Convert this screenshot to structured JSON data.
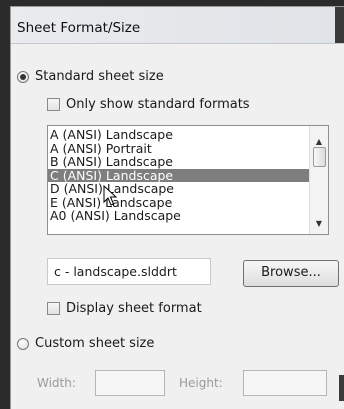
{
  "dialog": {
    "title": "Sheet Format/Size",
    "standard_size": {
      "label": "Standard sheet size",
      "selected": true
    },
    "only_standard": {
      "label": "Only show standard formats",
      "checked": false
    },
    "sheet_list": {
      "items": [
        "A (ANSI) Landscape",
        "A (ANSI) Portrait",
        "B (ANSI) Landscape",
        "C (ANSI) Landscape",
        "D (ANSI) Landscape",
        "E (ANSI) Landscape",
        "A0 (ANSI) Landscape"
      ],
      "selected_index": 3
    },
    "format_file": "c - landscape.slddrt",
    "browse_label": "Browse...",
    "display_format": {
      "label": "Display sheet format",
      "checked": false
    },
    "custom_size": {
      "label": "Custom sheet size",
      "selected": false
    },
    "width_label": "Width:",
    "height_label": "Height:"
  }
}
